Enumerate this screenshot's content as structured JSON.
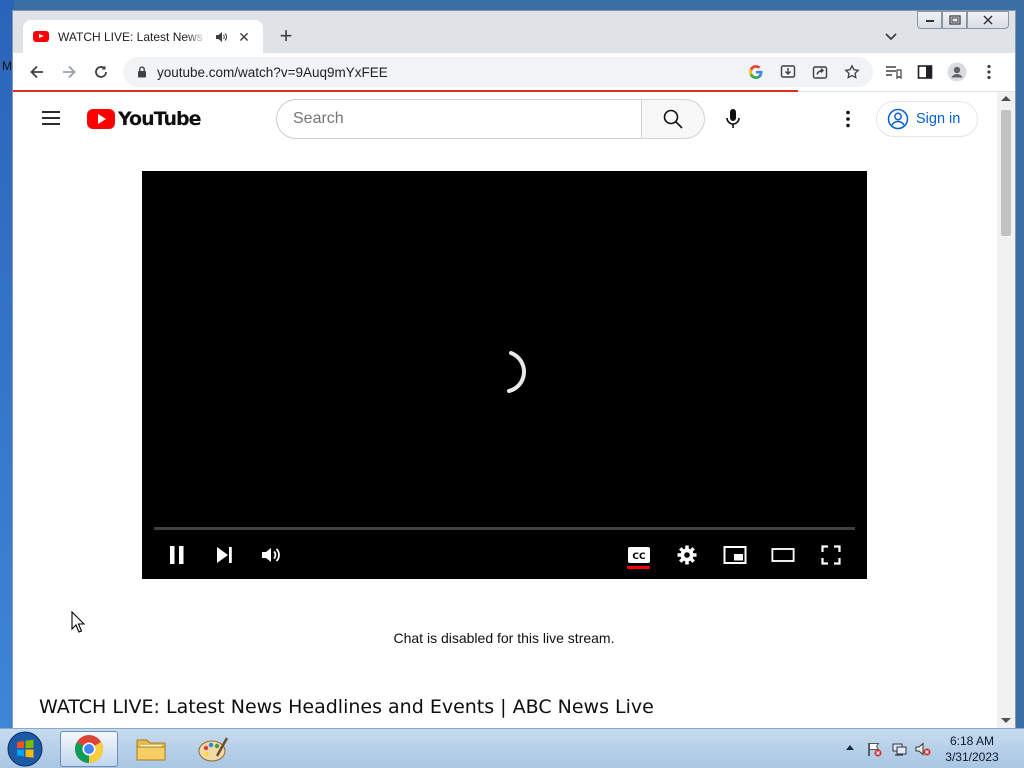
{
  "desktop": {
    "edge_letter": "M"
  },
  "browser": {
    "tab": {
      "title": "WATCH LIVE: Latest News Headlines and Events | ABC News Live"
    },
    "omnibox": {
      "url": "youtube.com/watch?v=9Auq9mYxFEE"
    }
  },
  "youtube": {
    "logo_text": "YouTube",
    "search": {
      "placeholder": "Search",
      "value": ""
    },
    "signin_label": "Sign in",
    "player": {
      "state": "loading"
    },
    "chat_message": "Chat is disabled for this live stream.",
    "video_title": "WATCH LIVE: Latest News Headlines and Events | ABC News Live"
  },
  "taskbar": {
    "items": [
      "start",
      "chrome",
      "file-explorer",
      "paint"
    ],
    "clock": {
      "time": "6:18 AM",
      "date": "3/31/2023"
    }
  },
  "colors": {
    "youtube_red": "#ff0000",
    "link_blue": "#065fd4",
    "loading_bar": "#d93025"
  }
}
